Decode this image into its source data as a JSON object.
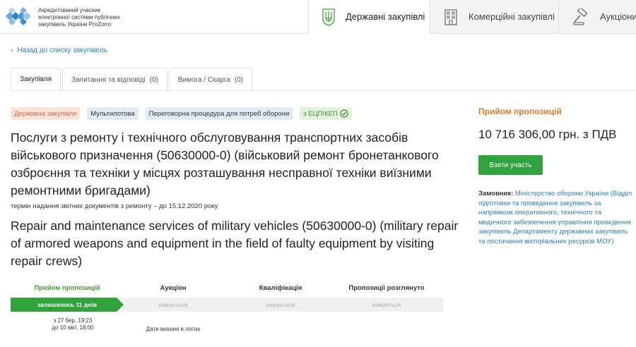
{
  "header": {
    "logo_lines": [
      "Акредитований учасник",
      "електронної системи публічних",
      "закупівель України ProZorro"
    ],
    "nav": [
      {
        "label": "Державні закупівлі",
        "icon": "trident-icon",
        "active": true
      },
      {
        "label": "Комерційні закупівлі",
        "icon": "building-icon",
        "active": false
      },
      {
        "label": "Аукціони",
        "icon": "gavel-icon",
        "active": false
      }
    ]
  },
  "back_link": "Назад до списку закупівель",
  "tabs": [
    {
      "label": "Закупівля",
      "count": ""
    },
    {
      "label": "Запитання та відповіді",
      "count": "(0)"
    },
    {
      "label": "Вимога / Скарга",
      "count": "(0)"
    }
  ],
  "tags": {
    "gov": "Державна закупівля",
    "multi": "Мультилотова",
    "procedure": "Переговорна процедура для потреб оборони",
    "signature": "з ЕЦП/КЕП"
  },
  "title_ua": "Послуги з ремонту і технічного обслуговування транспортних засобів військового призначення (50630000-0) (військовий ремонт бронетанкового озброєння та техніки у місцях розташування несправної техніки виїзними ремонтними бригадами)",
  "subnote": "термін надання звітних документів з ремонту – до 15.12.2020 року",
  "title_en": "Repair and maintenance services of military vehicles (50630000-0) (military repair of armored weapons and equipment in the field of faulty equipment by visiting repair crews)",
  "stages": {
    "labels": [
      "Прийом пропозицій",
      "Аукціон",
      "Кваліфікація",
      "Пропозиції розглянуто"
    ],
    "progress": [
      "залишилось 11 днів",
      "очікується",
      "очікується",
      "очікується"
    ],
    "dates_1": "з 27 бер. 19:23",
    "dates_2": "до 10 квіт. 18:00",
    "dates_lots": "Дати вказані в лотах"
  },
  "right": {
    "status": "Прийом пропозицій",
    "amount": "10 716 306,00 грн. з ПДВ",
    "button": "Взяти участь",
    "customer_label": "Замовник:",
    "customer_name": "Міністерство оборони України",
    "customer_detail": "(Відділ підготовки та проведення закупівель за напрямком оперативного, технічного та медичного забезпечення управління проведення закупівель Департаменту державних закупівель та постачання матеріальних ресурсів МОУ)"
  },
  "colors": {
    "accent_green": "#31a33c",
    "status_orange": "#e07b28",
    "link_blue": "#2a7fbf"
  }
}
